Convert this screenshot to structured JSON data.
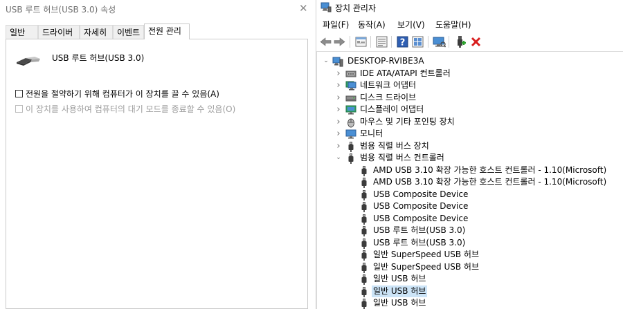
{
  "properties": {
    "title": "USB 루트 허브(USB 3.0) 속성",
    "close_glyph": "✕",
    "tabs": [
      "일반",
      "드라이버",
      "자세히",
      "이벤트",
      "전원 관리"
    ],
    "active_tab": 4,
    "device_name": "USB 루트 허브(USB 3.0)",
    "options": [
      {
        "label": "전원을 절약하기 위해 컴퓨터가 이 장치를 끌 수 있음(A)",
        "checked": false,
        "enabled": true
      },
      {
        "label": "이 장치를 사용하여 컴퓨터의 대기 모드를 종료할 수 있음(O)",
        "checked": false,
        "enabled": false
      }
    ]
  },
  "device_manager": {
    "title": "장치 관리자",
    "menus": [
      "파일(F)",
      "동작(A)",
      "보기(V)",
      "도움말(H)"
    ],
    "toolbar_icons": [
      "back-arrow-icon",
      "forward-arrow-icon",
      "properties-icon",
      "update-icon",
      "help-icon",
      "show-hidden-icon",
      "scan-monitor-icon",
      "enable-device-icon",
      "uninstall-x-icon"
    ],
    "tree": [
      {
        "label": "DESKTOP-RVIBE3A",
        "level": 0,
        "expander": "expanded",
        "icon": "computer"
      },
      {
        "label": "IDE ATA/ATAPI 컨트롤러",
        "level": 1,
        "expander": "collapsed",
        "icon": "ide"
      },
      {
        "label": "네트워크 어댑터",
        "level": 1,
        "expander": "collapsed",
        "icon": "network"
      },
      {
        "label": "디스크 드라이브",
        "level": 1,
        "expander": "collapsed",
        "icon": "disk"
      },
      {
        "label": "디스플레이 어댑터",
        "level": 1,
        "expander": "collapsed",
        "icon": "display"
      },
      {
        "label": "마우스 및 기타 포인팅 장치",
        "level": 1,
        "expander": "collapsed",
        "icon": "mouse"
      },
      {
        "label": "모니터",
        "level": 1,
        "expander": "collapsed",
        "icon": "monitor"
      },
      {
        "label": "범용 직렬 버스 장치",
        "level": 1,
        "expander": "collapsed",
        "icon": "usb"
      },
      {
        "label": "범용 직렬 버스 컨트롤러",
        "level": 1,
        "expander": "expanded",
        "icon": "usb"
      },
      {
        "label": "AMD USB 3.10 확장 가능한 호스트 컨트롤러 - 1.10(Microsoft)",
        "level": 2,
        "expander": "none",
        "icon": "usb"
      },
      {
        "label": "AMD USB 3.10 확장 가능한 호스트 컨트롤러 - 1.10(Microsoft)",
        "level": 2,
        "expander": "none",
        "icon": "usb"
      },
      {
        "label": "USB Composite Device",
        "level": 2,
        "expander": "none",
        "icon": "usb"
      },
      {
        "label": "USB Composite Device",
        "level": 2,
        "expander": "none",
        "icon": "usb"
      },
      {
        "label": "USB Composite Device",
        "level": 2,
        "expander": "none",
        "icon": "usb"
      },
      {
        "label": "USB 루트 허브(USB 3.0)",
        "level": 2,
        "expander": "none",
        "icon": "usb"
      },
      {
        "label": "USB 루트 허브(USB 3.0)",
        "level": 2,
        "expander": "none",
        "icon": "usb"
      },
      {
        "label": "일반 SuperSpeed USB 허브",
        "level": 2,
        "expander": "none",
        "icon": "usb"
      },
      {
        "label": "일반 SuperSpeed USB 허브",
        "level": 2,
        "expander": "none",
        "icon": "usb"
      },
      {
        "label": "일반 USB 허브",
        "level": 2,
        "expander": "none",
        "icon": "usb"
      },
      {
        "label": "일반 USB 허브",
        "level": 2,
        "expander": "none",
        "icon": "usb",
        "selected": true
      },
      {
        "label": "일반 USB 허브",
        "level": 2,
        "expander": "none",
        "icon": "usb"
      }
    ],
    "selection_color": "#cce4f7"
  }
}
